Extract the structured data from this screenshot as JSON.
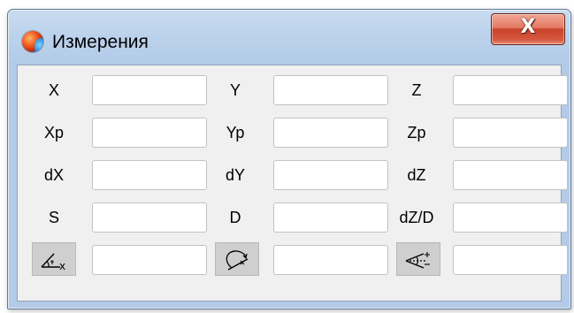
{
  "window": {
    "title": "Измерения",
    "close_label": "X"
  },
  "icons": {
    "app": "app-globe-icon",
    "close": "close-icon",
    "angle_x": "angle-x-icon",
    "angle_rotation": "angle-rotation-icon",
    "angle_sight": "angle-sight-icon"
  },
  "rows": [
    {
      "labels": [
        "X",
        "Y",
        "Z"
      ]
    },
    {
      "labels": [
        "Xp",
        "Yp",
        "Zp"
      ]
    },
    {
      "labels": [
        "dX",
        "dY",
        "dZ"
      ]
    },
    {
      "labels": [
        "S",
        "D",
        "dZ/D"
      ]
    }
  ],
  "colors": {
    "close_button": "#d4583f",
    "window_frame": "#b3cbe8",
    "client_bg": "#f0f0f0"
  }
}
